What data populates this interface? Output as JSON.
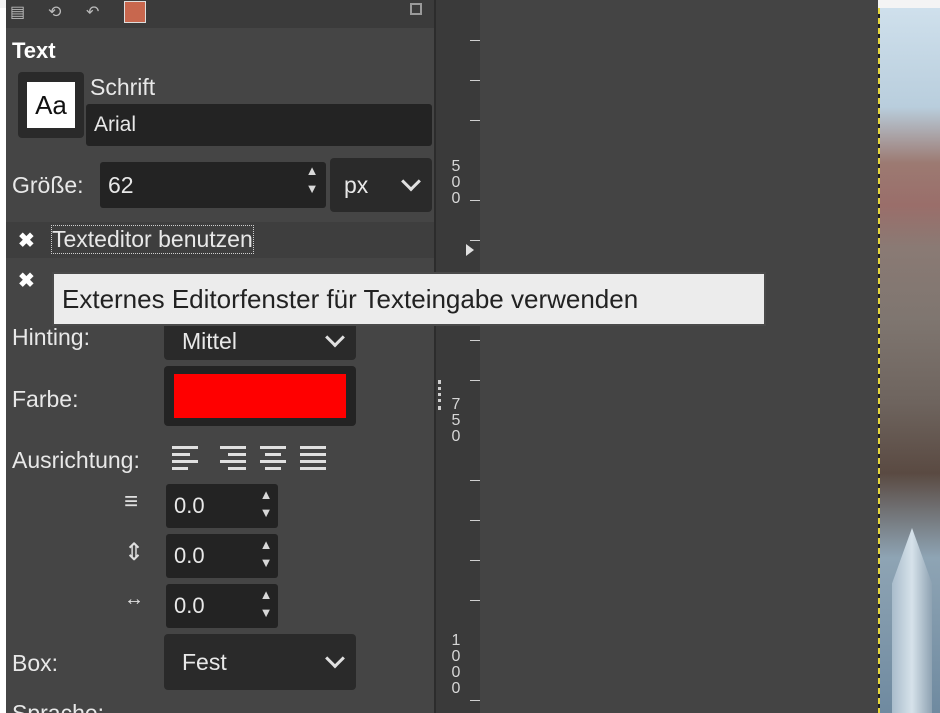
{
  "panel": {
    "section_title": "Text",
    "font_label": "Schrift",
    "font_preview": "Aa",
    "font_value": "Arial",
    "size_label": "Größe:",
    "size_value": "62",
    "size_unit": "px",
    "use_editor_label": "Texteditor benutzen",
    "hinting_label": "Hinting:",
    "hinting_value": "Mittel",
    "color_label": "Farbe:",
    "color_value": "#ff0000",
    "align_label": "Ausrichtung:",
    "indent_value": "0.0",
    "line_spacing_value": "0.0",
    "letter_spacing_value": "0.0",
    "box_label": "Box:",
    "box_value": "Fest",
    "language_label": "Sprache:"
  },
  "tooltip": {
    "text": "Externes Editorfenster für Texteingabe verwenden"
  },
  "ruler": {
    "mark_500": [
      "5",
      "0",
      "0"
    ],
    "mark_750": [
      "7",
      "5",
      "0"
    ],
    "mark_1000": [
      "1",
      "0",
      "0",
      "0"
    ]
  }
}
